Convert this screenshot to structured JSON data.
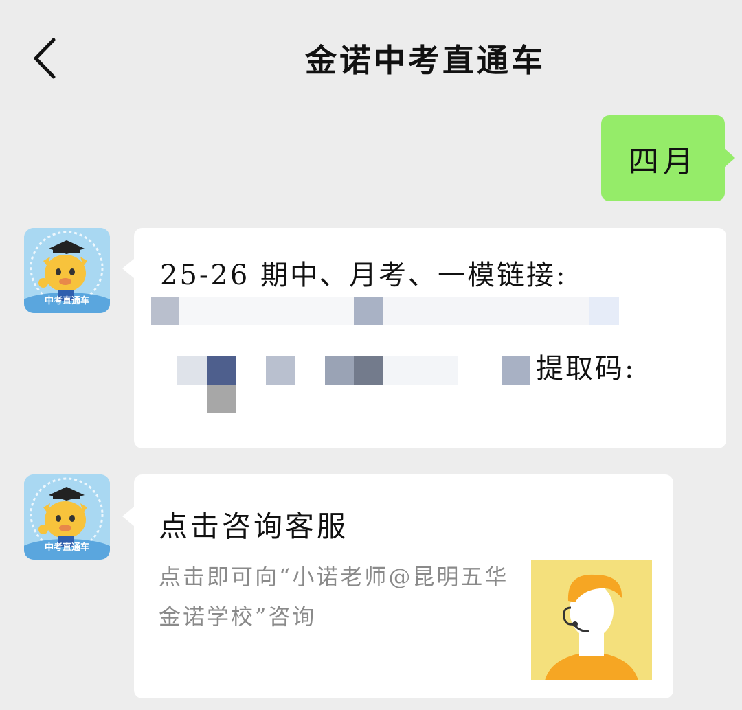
{
  "header": {
    "title": "金诺中考直通车",
    "back_icon": "chevron-left-icon"
  },
  "messages": {
    "outgoing": {
      "text": "四月",
      "bubble_color": "#95ec69"
    },
    "incoming_1": {
      "line1": "25-26 期中、月考、一模链接:",
      "code_label": "提取码:",
      "redacted": true
    },
    "incoming_2": {
      "card_title": "点击咨询客服",
      "card_description": "点击即可向“小诺老师@昆明五华金诺学校”咨询"
    }
  },
  "avatar": {
    "label": "中考直通车",
    "icon": "cartoon-ox-graduate-icon",
    "background": "#a9d8f2"
  },
  "colors": {
    "page_bg": "#ededed",
    "bubble_bg": "#ffffff",
    "desc_text": "#8a8a8a",
    "thumb_bg": "#f4e07c",
    "thumb_accent": "#f6a623"
  }
}
